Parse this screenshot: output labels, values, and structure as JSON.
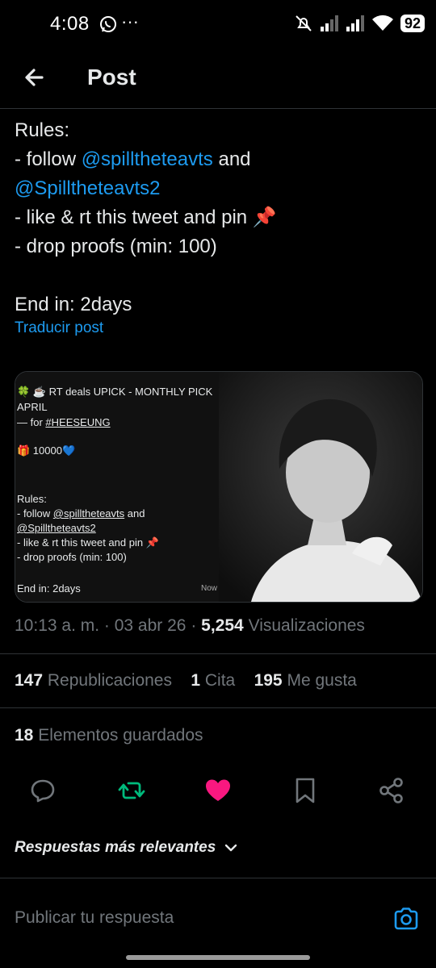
{
  "status_bar": {
    "time": "4:08",
    "more": "···",
    "battery": "92"
  },
  "header": {
    "title": "Post"
  },
  "tweet": {
    "lines": [
      {
        "text": "Rules:"
      },
      {
        "prefix": "- follow ",
        "mention": "@spilltheteavts",
        "suffix": " and"
      },
      {
        "mention": "@Spilltheteavts2"
      },
      {
        "text": "- like & rt this tweet and pin 📌"
      },
      {
        "text": "- drop proofs (min: 100)"
      },
      {
        "text": ""
      },
      {
        "text": "End in: 2days"
      }
    ],
    "translate": "Traducir post"
  },
  "media": {
    "lines": [
      "🍀 ☕ RT deals  UPICK - MONTHLY PICK",
      "APRIL",
      "— for #HEESEUNG",
      "🎁 10000💙",
      "Rules:",
      "- follow @spilltheteavts and",
      "@Spilltheteavts2",
      "- like & rt this tweet and pin 📌",
      "- drop proofs (min: 100)",
      "End in: 2days"
    ],
    "corner": "Now"
  },
  "meta": {
    "time": "10:13 a. m.",
    "date": "03 abr 26",
    "views_count": "5,254",
    "views_label": "Visualizaciones"
  },
  "stats": {
    "reposts_count": "147",
    "reposts_label": "Republicaciones",
    "quotes_count": "1",
    "quotes_label": "Cita",
    "likes_count": "195",
    "likes_label": "Me gusta",
    "bookmarks_count": "18",
    "bookmarks_label": "Elementos guardados"
  },
  "actions": {
    "reply_icon": "reply-icon",
    "retweet_icon": "retweet-icon",
    "like_icon": "heart-icon",
    "bookmark_icon": "bookmark-icon",
    "share_icon": "share-icon"
  },
  "replies": {
    "sort_label": "Respuestas más relevantes",
    "input_placeholder": "Publicar tu respuesta"
  },
  "colors": {
    "background": "#000000",
    "text": "#e7e9ea",
    "muted": "#71767b",
    "accent": "#1d9bf0",
    "retweet_active": "#00ba7c",
    "like_active": "#f91880",
    "divider": "#2f3336"
  }
}
